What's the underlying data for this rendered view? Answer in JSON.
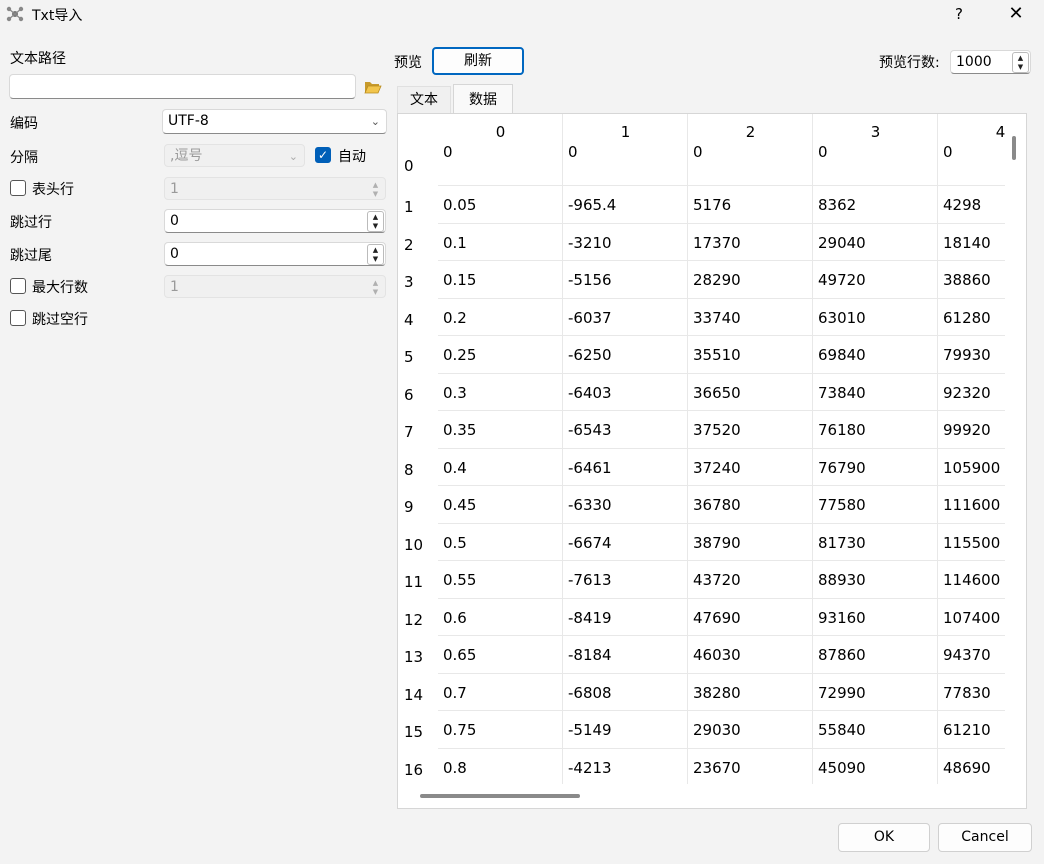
{
  "window": {
    "title": "Txt导入",
    "help": "?",
    "close": "✕"
  },
  "left": {
    "path_label": "文本路径",
    "path_value": "",
    "encoding_label": "编码",
    "encoding_value": "UTF-8",
    "separator_label": "分隔",
    "separator_value": ",逗号",
    "auto_label": "自动",
    "auto_checked": true,
    "header_label": "表头行",
    "header_value": "1",
    "skip_label": "跳过行",
    "skip_value": "0",
    "skip_tail_label": "跳过尾",
    "skip_tail_value": "0",
    "max_rows_label": "最大行数",
    "max_rows_value": "1",
    "skip_blank_label": "跳过空行"
  },
  "preview": {
    "label": "预览",
    "refresh": "刷新",
    "rows_label": "预览行数:",
    "rows_value": "1000"
  },
  "tabs": [
    "文本",
    "数据"
  ],
  "table": {
    "columns": [
      "0",
      "1",
      "2",
      "3",
      "4"
    ],
    "rows": [
      [
        "0",
        "0",
        "0",
        "0",
        "0"
      ],
      [
        "0.05",
        "-965.4",
        "5176",
        "8362",
        "4298"
      ],
      [
        "0.1",
        "-3210",
        "17370",
        "29040",
        "18140"
      ],
      [
        "0.15",
        "-5156",
        "28290",
        "49720",
        "38860"
      ],
      [
        "0.2",
        "-6037",
        "33740",
        "63010",
        "61280"
      ],
      [
        "0.25",
        "-6250",
        "35510",
        "69840",
        "79930"
      ],
      [
        "0.3",
        "-6403",
        "36650",
        "73840",
        "92320"
      ],
      [
        "0.35",
        "-6543",
        "37520",
        "76180",
        "99920"
      ],
      [
        "0.4",
        "-6461",
        "37240",
        "76790",
        "105900"
      ],
      [
        "0.45",
        "-6330",
        "36780",
        "77580",
        "111600"
      ],
      [
        "0.5",
        "-6674",
        "38790",
        "81730",
        "115500"
      ],
      [
        "0.55",
        "-7613",
        "43720",
        "88930",
        "114600"
      ],
      [
        "0.6",
        "-8419",
        "47690",
        "93160",
        "107400"
      ],
      [
        "0.65",
        "-8184",
        "46030",
        "87860",
        "94370"
      ],
      [
        "0.7",
        "-6808",
        "38280",
        "72990",
        "77830"
      ],
      [
        "0.75",
        "-5149",
        "29030",
        "55840",
        "61210"
      ],
      [
        "0.8",
        "-4213",
        "23670",
        "45090",
        "48690"
      ]
    ]
  },
  "footer": {
    "ok": "OK",
    "cancel": "Cancel"
  }
}
